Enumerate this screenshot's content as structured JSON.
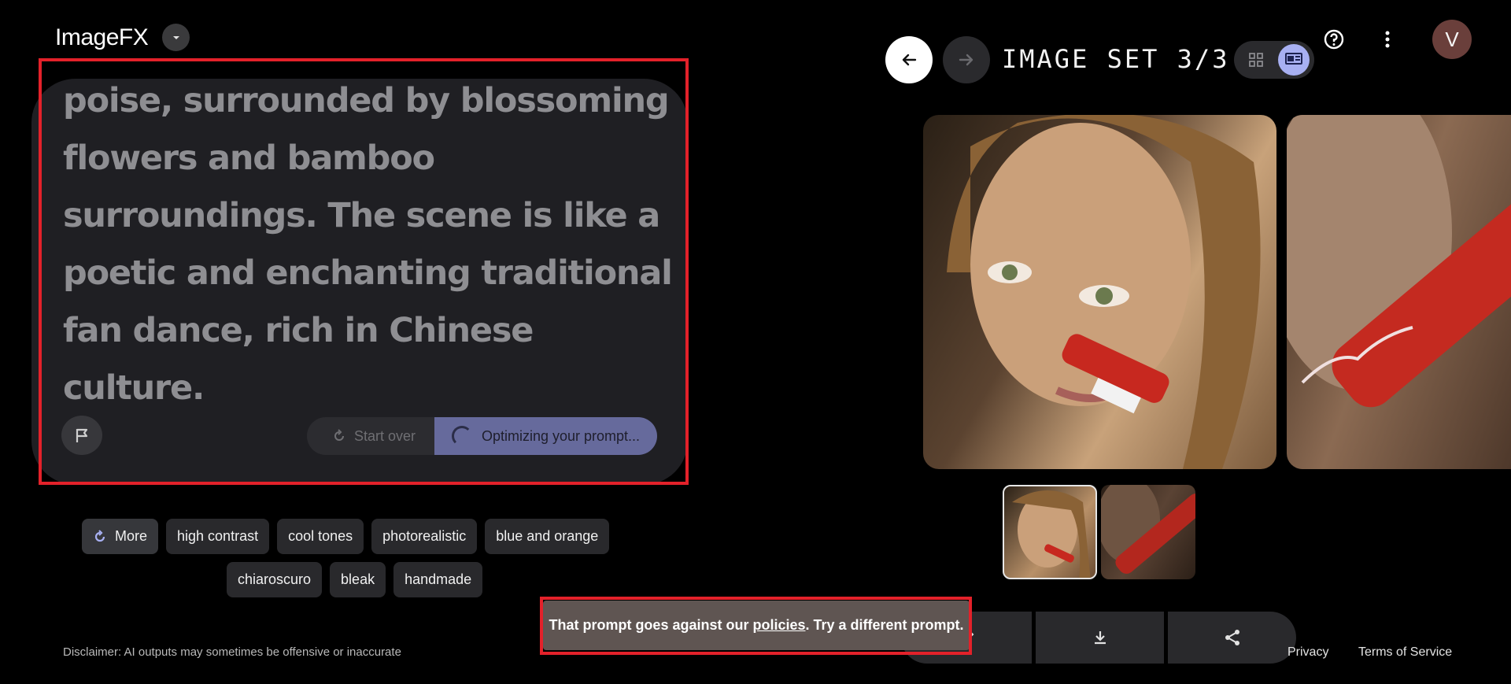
{
  "app": {
    "title": "ImageFX"
  },
  "prompt": {
    "text": "poise, surrounded by blossoming flowers and bamboo surroundings. The scene is like a poetic and enchanting traditional fan dance, rich in Chinese culture.",
    "start_over_label": "Start over",
    "optimizing_label": "Optimizing your prompt..."
  },
  "chips": {
    "more_label": "More",
    "row1": [
      "high contrast",
      "cool tones",
      "photorealistic",
      "blue and orange"
    ],
    "row2": [
      "chiaroscuro",
      "bleak",
      "handmade"
    ]
  },
  "disclaimer": "Disclaimer: AI outputs may sometimes be offensive or inaccurate",
  "viewer": {
    "set_label": "IMAGE SET 3/3",
    "avatar_letter": "V"
  },
  "footer": {
    "privacy": "Privacy",
    "terms": "Terms of Service"
  },
  "toast": {
    "before": "That prompt goes against our ",
    "link": "policies",
    "after": ". Try a different prompt."
  },
  "colors": {
    "accent": "#a8b0f2",
    "highlight_box": "#e3212a",
    "toast_bg": "#5f5552"
  }
}
